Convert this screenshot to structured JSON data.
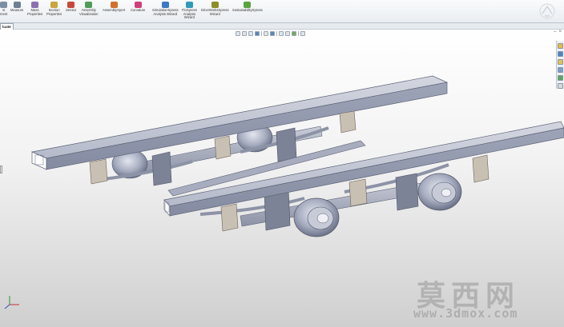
{
  "ribbon": {
    "tools": [
      {
        "label": "nt\nment",
        "icon": "measure-partial-icon",
        "color": "#7d8fa3"
      },
      {
        "label": "Measure",
        "icon": "measure-icon",
        "color": "#6d7f94"
      },
      {
        "label": "Mass\nProperties",
        "icon": "mass-properties-icon",
        "color": "#8b6fb0"
      },
      {
        "label": "Section\nProperties",
        "icon": "section-properties-icon",
        "color": "#c9a640"
      },
      {
        "label": "Sensor",
        "icon": "sensor-icon",
        "color": "#c7483a"
      },
      {
        "label": "Assembly\nVisualization",
        "icon": "assembly-visualization-icon",
        "color": "#4f9d58"
      },
      {
        "label": "AssemblyXpert",
        "icon": "assemblyxpert-icon",
        "color": "#d0702c"
      },
      {
        "label": "Curvature",
        "icon": "curvature-icon",
        "color": "#cf3e7a"
      },
      {
        "label": "SimulationXpress\nAnalysis Wizard",
        "icon": "simulationxpress-icon",
        "color": "#3d79c4"
      },
      {
        "label": "FloXpress\nAnalysis\nWizard",
        "icon": "floxpress-icon",
        "color": "#2f9bb8"
      },
      {
        "label": "DriveWorksXpress\nWizard",
        "icon": "driveworksxpress-icon",
        "color": "#8e8e2a"
      },
      {
        "label": "SustainabilityXpress",
        "icon": "sustainabilityxpress-icon",
        "color": "#5aa43c"
      }
    ]
  },
  "tab": {
    "label": "luate"
  },
  "watermark": {
    "chars": "莫西网",
    "url": "www.3dmox.com"
  },
  "colors": {
    "frame": "#b8bdcc",
    "frame_dark": "#8e94a8",
    "axle": "#a9aec0",
    "bracket": "#c9c0b4"
  }
}
